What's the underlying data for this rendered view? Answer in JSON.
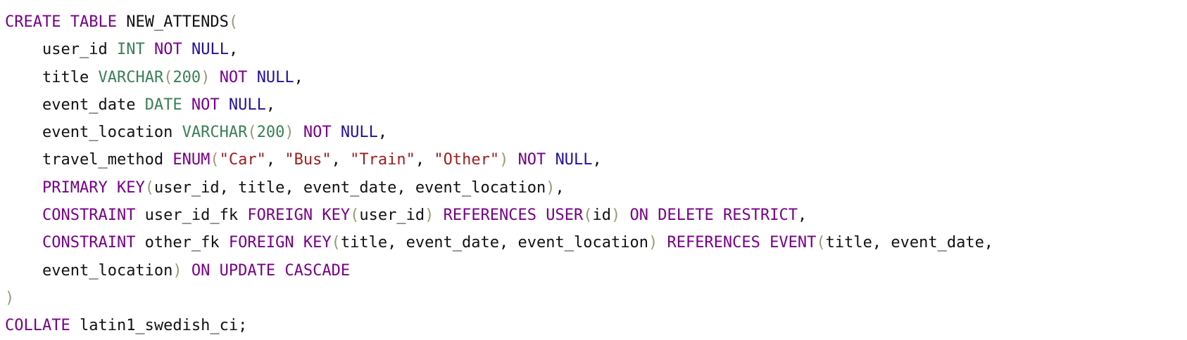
{
  "editor": {
    "indent": "    ",
    "colors": {
      "keyword": "#770088",
      "type": "#3a7f55",
      "null": "#221199",
      "string": "#a11d1d",
      "punctuation": "#999977",
      "plain": "#111111",
      "background": "#ffffff"
    },
    "lines": [
      {
        "indent": false,
        "tokens": [
          {
            "t": "CREATE",
            "k": "kw"
          },
          {
            "t": " ",
            "k": "plain"
          },
          {
            "t": "TABLE",
            "k": "kw"
          },
          {
            "t": " NEW_ATTENDS",
            "k": "plain"
          },
          {
            "t": "(",
            "k": "punct"
          }
        ]
      },
      {
        "indent": true,
        "tokens": [
          {
            "t": "user_id ",
            "k": "plain"
          },
          {
            "t": "INT",
            "k": "type"
          },
          {
            "t": " ",
            "k": "plain"
          },
          {
            "t": "NOT",
            "k": "kw"
          },
          {
            "t": " ",
            "k": "plain"
          },
          {
            "t": "NULL",
            "k": "null"
          },
          {
            "t": ",",
            "k": "plain"
          }
        ]
      },
      {
        "indent": true,
        "tokens": [
          {
            "t": "title ",
            "k": "plain"
          },
          {
            "t": "VARCHAR",
            "k": "type"
          },
          {
            "t": "(",
            "k": "punct"
          },
          {
            "t": "200",
            "k": "type"
          },
          {
            "t": ")",
            "k": "punct"
          },
          {
            "t": " ",
            "k": "plain"
          },
          {
            "t": "NOT",
            "k": "kw"
          },
          {
            "t": " ",
            "k": "plain"
          },
          {
            "t": "NULL",
            "k": "null"
          },
          {
            "t": ",",
            "k": "plain"
          }
        ]
      },
      {
        "indent": true,
        "tokens": [
          {
            "t": "event_date ",
            "k": "plain"
          },
          {
            "t": "DATE",
            "k": "type"
          },
          {
            "t": " ",
            "k": "plain"
          },
          {
            "t": "NOT",
            "k": "kw"
          },
          {
            "t": " ",
            "k": "plain"
          },
          {
            "t": "NULL",
            "k": "null"
          },
          {
            "t": ",",
            "k": "plain"
          }
        ]
      },
      {
        "indent": true,
        "tokens": [
          {
            "t": "event_location ",
            "k": "plain"
          },
          {
            "t": "VARCHAR",
            "k": "type"
          },
          {
            "t": "(",
            "k": "punct"
          },
          {
            "t": "200",
            "k": "type"
          },
          {
            "t": ")",
            "k": "punct"
          },
          {
            "t": " ",
            "k": "plain"
          },
          {
            "t": "NOT",
            "k": "kw"
          },
          {
            "t": " ",
            "k": "plain"
          },
          {
            "t": "NULL",
            "k": "null"
          },
          {
            "t": ",",
            "k": "plain"
          }
        ]
      },
      {
        "indent": true,
        "tokens": [
          {
            "t": "travel_method ",
            "k": "plain"
          },
          {
            "t": "ENUM",
            "k": "kw"
          },
          {
            "t": "(",
            "k": "punct"
          },
          {
            "t": "\"Car\"",
            "k": "str"
          },
          {
            "t": ", ",
            "k": "plain"
          },
          {
            "t": "\"Bus\"",
            "k": "str"
          },
          {
            "t": ", ",
            "k": "plain"
          },
          {
            "t": "\"Train\"",
            "k": "str"
          },
          {
            "t": ", ",
            "k": "plain"
          },
          {
            "t": "\"Other\"",
            "k": "str"
          },
          {
            "t": ")",
            "k": "punct"
          },
          {
            "t": " ",
            "k": "plain"
          },
          {
            "t": "NOT",
            "k": "kw"
          },
          {
            "t": " ",
            "k": "plain"
          },
          {
            "t": "NULL",
            "k": "null"
          },
          {
            "t": ",",
            "k": "plain"
          }
        ]
      },
      {
        "indent": true,
        "tokens": [
          {
            "t": "PRIMARY",
            "k": "kw"
          },
          {
            "t": " ",
            "k": "plain"
          },
          {
            "t": "KEY",
            "k": "kw"
          },
          {
            "t": "(",
            "k": "punct"
          },
          {
            "t": "user_id, title, event_date, event_location",
            "k": "plain"
          },
          {
            "t": ")",
            "k": "punct"
          },
          {
            "t": ",",
            "k": "plain"
          }
        ]
      },
      {
        "indent": true,
        "tokens": [
          {
            "t": "CONSTRAINT",
            "k": "kw"
          },
          {
            "t": " user_id_fk ",
            "k": "plain"
          },
          {
            "t": "FOREIGN",
            "k": "kw"
          },
          {
            "t": " ",
            "k": "plain"
          },
          {
            "t": "KEY",
            "k": "kw"
          },
          {
            "t": "(",
            "k": "punct"
          },
          {
            "t": "user_id",
            "k": "plain"
          },
          {
            "t": ")",
            "k": "punct"
          },
          {
            "t": " ",
            "k": "plain"
          },
          {
            "t": "REFERENCES",
            "k": "kw"
          },
          {
            "t": " ",
            "k": "plain"
          },
          {
            "t": "USER",
            "k": "kw"
          },
          {
            "t": "(",
            "k": "punct"
          },
          {
            "t": "id",
            "k": "plain"
          },
          {
            "t": ")",
            "k": "punct"
          },
          {
            "t": " ",
            "k": "plain"
          },
          {
            "t": "ON",
            "k": "kw"
          },
          {
            "t": " ",
            "k": "plain"
          },
          {
            "t": "DELETE",
            "k": "kw"
          },
          {
            "t": " ",
            "k": "plain"
          },
          {
            "t": "RESTRICT",
            "k": "kw"
          },
          {
            "t": ",",
            "k": "plain"
          }
        ]
      },
      {
        "indent": true,
        "tokens": [
          {
            "t": "CONSTRAINT",
            "k": "kw"
          },
          {
            "t": " other_fk ",
            "k": "plain"
          },
          {
            "t": "FOREIGN",
            "k": "kw"
          },
          {
            "t": " ",
            "k": "plain"
          },
          {
            "t": "KEY",
            "k": "kw"
          },
          {
            "t": "(",
            "k": "punct"
          },
          {
            "t": "title, event_date, event_location",
            "k": "plain"
          },
          {
            "t": ")",
            "k": "punct"
          },
          {
            "t": " ",
            "k": "plain"
          },
          {
            "t": "REFERENCES",
            "k": "kw"
          },
          {
            "t": " ",
            "k": "plain"
          },
          {
            "t": "EVENT",
            "k": "kw"
          },
          {
            "t": "(",
            "k": "punct"
          },
          {
            "t": "title, event_date,",
            "k": "plain"
          }
        ]
      },
      {
        "indent": true,
        "tokens": [
          {
            "t": "event_location",
            "k": "plain"
          },
          {
            "t": ")",
            "k": "punct"
          },
          {
            "t": " ",
            "k": "plain"
          },
          {
            "t": "ON",
            "k": "kw"
          },
          {
            "t": " ",
            "k": "plain"
          },
          {
            "t": "UPDATE",
            "k": "kw"
          },
          {
            "t": " ",
            "k": "plain"
          },
          {
            "t": "CASCADE",
            "k": "kw"
          }
        ]
      },
      {
        "indent": false,
        "tokens": [
          {
            "t": ")",
            "k": "punct"
          }
        ]
      },
      {
        "indent": false,
        "tokens": [
          {
            "t": "COLLATE",
            "k": "kw"
          },
          {
            "t": " latin1_swedish_ci;",
            "k": "plain"
          }
        ]
      }
    ]
  }
}
